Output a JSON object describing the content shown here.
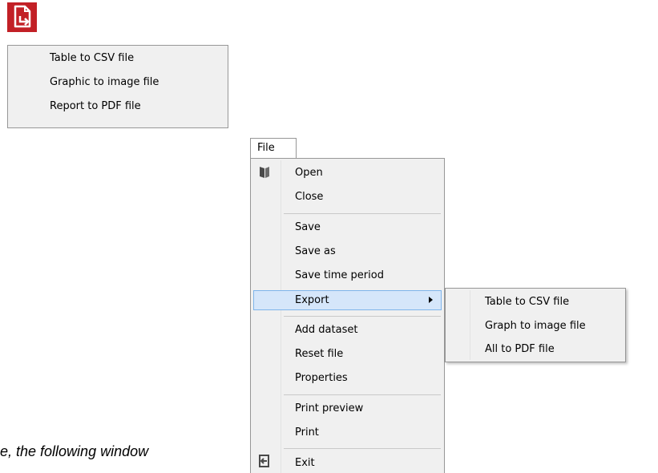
{
  "export_button": {
    "icon": "export-document-icon",
    "color": "#c22026"
  },
  "export_dropdown": {
    "items": [
      {
        "label": "Table to CSV file"
      },
      {
        "label": "Graphic to image file"
      },
      {
        "label": "Report to PDF file"
      }
    ]
  },
  "file_menu": {
    "tab_label": "File",
    "items": [
      {
        "label": "Open",
        "icon": "open-book-icon"
      },
      {
        "label": "Close"
      },
      {
        "label": "Save"
      },
      {
        "label": "Save as"
      },
      {
        "label": "Save time period"
      },
      {
        "label": "Export",
        "highlighted": true,
        "has_submenu": true
      },
      {
        "label": "Add dataset"
      },
      {
        "label": "Reset file"
      },
      {
        "label": "Properties"
      },
      {
        "label": "Print preview"
      },
      {
        "label": "Print"
      },
      {
        "label": "Exit",
        "icon": "exit-icon"
      }
    ],
    "highlight_color": "#d5e6fa"
  },
  "export_submenu": {
    "items": [
      {
        "label": "Table to CSV file"
      },
      {
        "label": "Graph to image file"
      },
      {
        "label": "All to PDF file"
      }
    ]
  },
  "caption": {
    "text": "e, the following window"
  }
}
